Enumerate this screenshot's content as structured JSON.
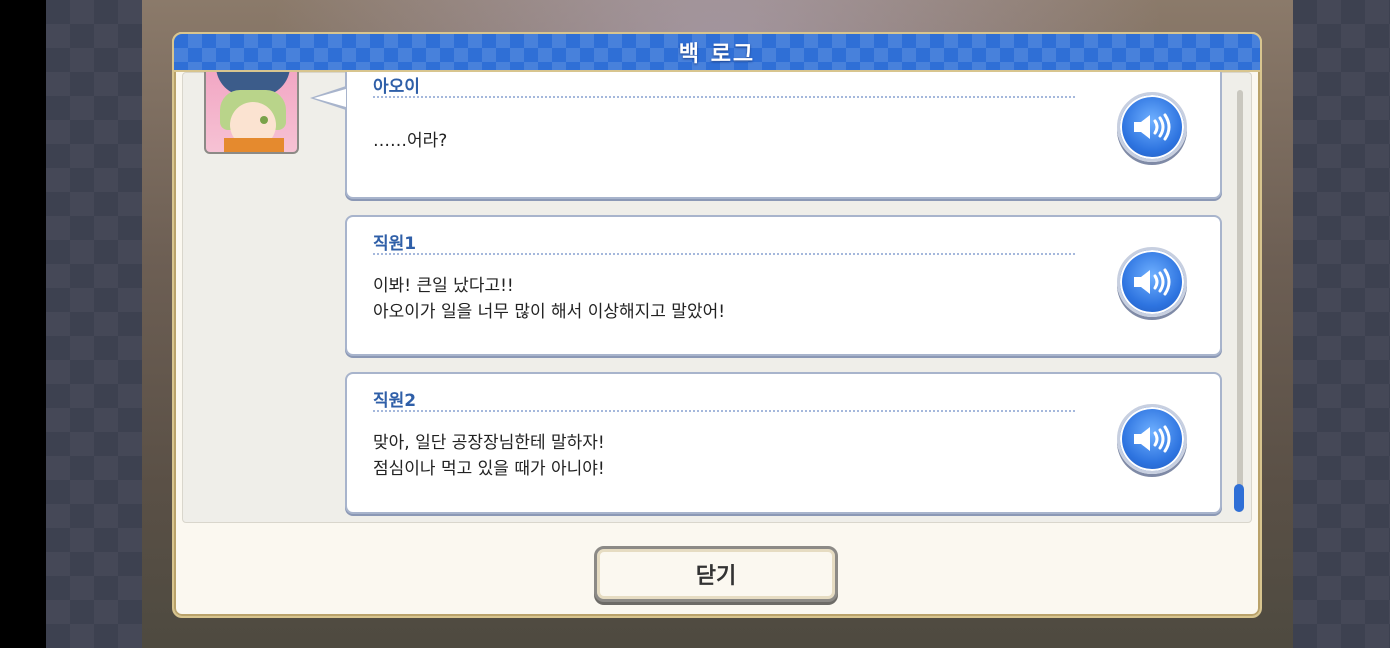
{
  "window": {
    "title": "백 로그"
  },
  "log": {
    "entries": [
      {
        "speaker": "아오이",
        "message": "……어라?",
        "has_portrait": true
      },
      {
        "speaker": "직원1",
        "message": "이봐! 큰일 났다고!!\n아오이가 일을 너무 많이 해서 이상해지고 말았어!",
        "has_portrait": false
      },
      {
        "speaker": "직원2",
        "message": "맞아, 일단 공장장님한테 말하자!\n점심이나 먹고 있을 때가 아니야!",
        "has_portrait": false
      }
    ],
    "voice_icon": "speaker-sound-icon"
  },
  "footer": {
    "close_label": "닫기"
  },
  "colors": {
    "title_bar": "#2f6fd6",
    "speaker_name": "#2f5fa8",
    "panel_bg": "#fbf8f0",
    "frame_gold": "#d8c58f",
    "scroll_thumb": "#2f6fd6"
  }
}
